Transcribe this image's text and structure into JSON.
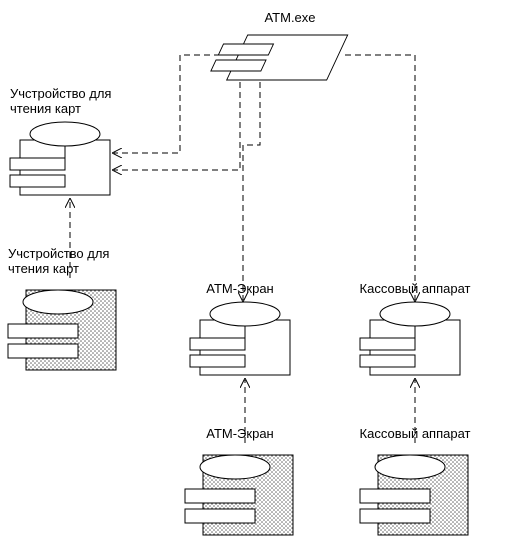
{
  "nodes": {
    "atm_exe": "ATM.exe",
    "card_reader_iface_line1": "Учстройство для",
    "card_reader_iface_line2": "чтения карт",
    "card_reader_comp_line1": "Учстройство для",
    "card_reader_comp_line2": "чтения карт",
    "screen_iface": "ATM-Экран",
    "screen_comp": "ATM-Экран",
    "cash_iface": "Кассовый аппарат",
    "cash_comp": "Кассовый аппарат"
  }
}
